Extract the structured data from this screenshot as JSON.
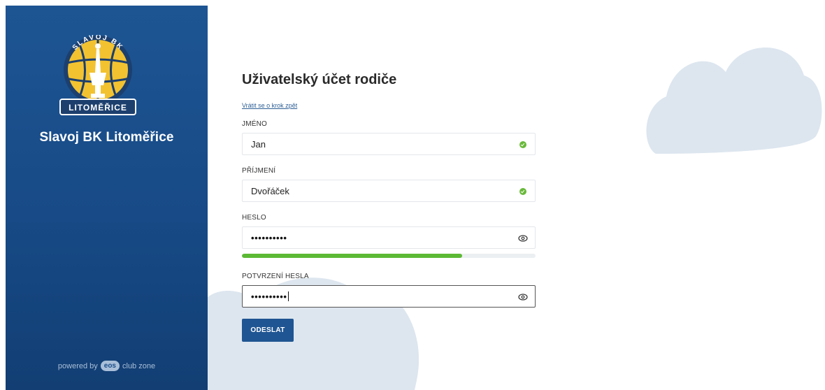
{
  "sidebar": {
    "logo": {
      "top_text": "SLAVOJ BK",
      "bottom_text": "LITOMĚŘICE",
      "colors": {
        "navy": "#1c3f6e",
        "yellow": "#f2c230"
      }
    },
    "club_name": "Slavoj BK Litoměřice",
    "powered_by": {
      "prefix": "powered by",
      "badge": "eos",
      "suffix": "club zone"
    }
  },
  "form": {
    "title": "Uživatelský účet rodiče",
    "back_link": "Vrátit se o krok zpět",
    "first_name": {
      "label": "JMÉNO",
      "value": "Jan",
      "valid": true
    },
    "last_name": {
      "label": "PŘÍJMENÍ",
      "value": "Dvořáček",
      "valid": true
    },
    "password": {
      "label": "HESLO",
      "value": "••••••••••",
      "icon": "eye-icon",
      "strength_percent": 75
    },
    "password_confirm": {
      "label": "POTVRZENÍ HESLA",
      "value": "••••••••••",
      "icon": "eye-icon",
      "focused": true
    },
    "submit_label": "ODESLAT"
  },
  "colors": {
    "sidebar_blue": "#1d5593",
    "button_blue": "#1f5592",
    "cloud": "#dde6ef",
    "valid_green": "#69b93a",
    "strength_green": "#5cb934",
    "link_blue": "#2d5f96"
  }
}
